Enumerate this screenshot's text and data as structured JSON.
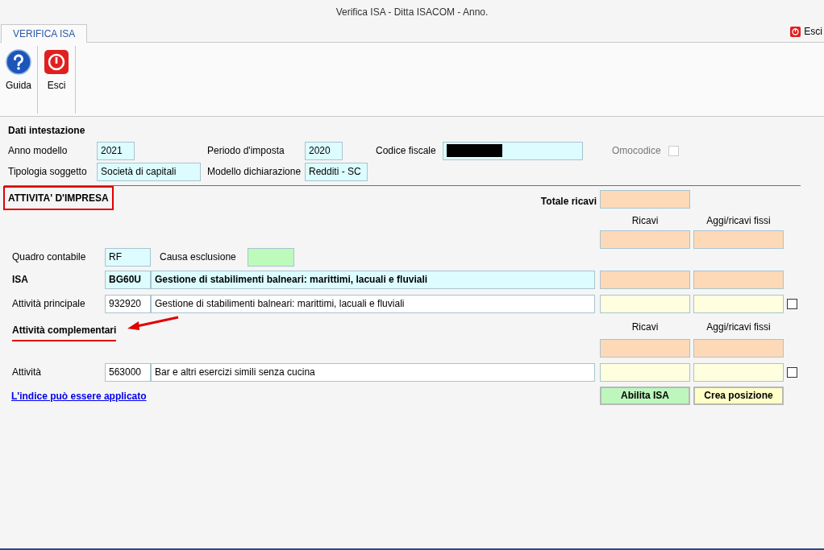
{
  "window": {
    "title": "Verifica ISA - Ditta ISACOM - Anno."
  },
  "tabs": [
    {
      "label": "VERIFICA ISA",
      "selected": true
    }
  ],
  "exit_link": "Esci",
  "toolbar": [
    {
      "label": "Guida",
      "kind": "help"
    },
    {
      "label": "Esci",
      "kind": "exit"
    }
  ],
  "header": {
    "title": "Dati intestazione",
    "anno_modello": {
      "label": "Anno modello",
      "value": "2021"
    },
    "periodo_imposta": {
      "label": "Periodo d'imposta",
      "value": "2020"
    },
    "codice_fiscale": {
      "label": "Codice fiscale",
      "redacted": true
    },
    "omocodice": {
      "label": "Omocodice",
      "checked": false,
      "disabled": true
    },
    "tipologia_soggetto": {
      "label": "Tipologia soggetto",
      "value": "Società di capitali"
    },
    "modello_dichiarazione": {
      "label": "Modello dichiarazione",
      "value": "Redditi - SC"
    }
  },
  "impresa": {
    "title": "ATTIVITA' D'IMPRESA",
    "highlighted": true,
    "totale_ricavi": "Totale ricavi",
    "columns": [
      "Ricavi",
      "Aggi/ricavi fissi"
    ],
    "quadro_contabile": {
      "label": "Quadro contabile",
      "value": "RF"
    },
    "causa_esclusione": {
      "label": "Causa esclusione"
    },
    "isa": {
      "label": "ISA",
      "code": "BG60U",
      "description": "Gestione di stabilimenti balneari: marittimi, lacuali e fluviali"
    },
    "principale": {
      "label": "Attività principale",
      "code": "932920",
      "description": "Gestione di stabilimenti balneari: marittimi, lacuali e fluviali",
      "checked": false
    }
  },
  "complementari": {
    "title": "Attività complementari",
    "highlighted": true,
    "columns": [
      "Ricavi",
      "Aggi/ricavi fissi"
    ],
    "rows": [
      {
        "label": "Attività",
        "code": "563000",
        "description": "Bar e altri esercizi simili senza cucina",
        "checked": false
      }
    ]
  },
  "link": "L'indice può essere applicato",
  "buttons": [
    {
      "label": "Abilita ISA",
      "kind": "enable"
    },
    {
      "label": "Crea posizione",
      "kind": "create"
    }
  ]
}
